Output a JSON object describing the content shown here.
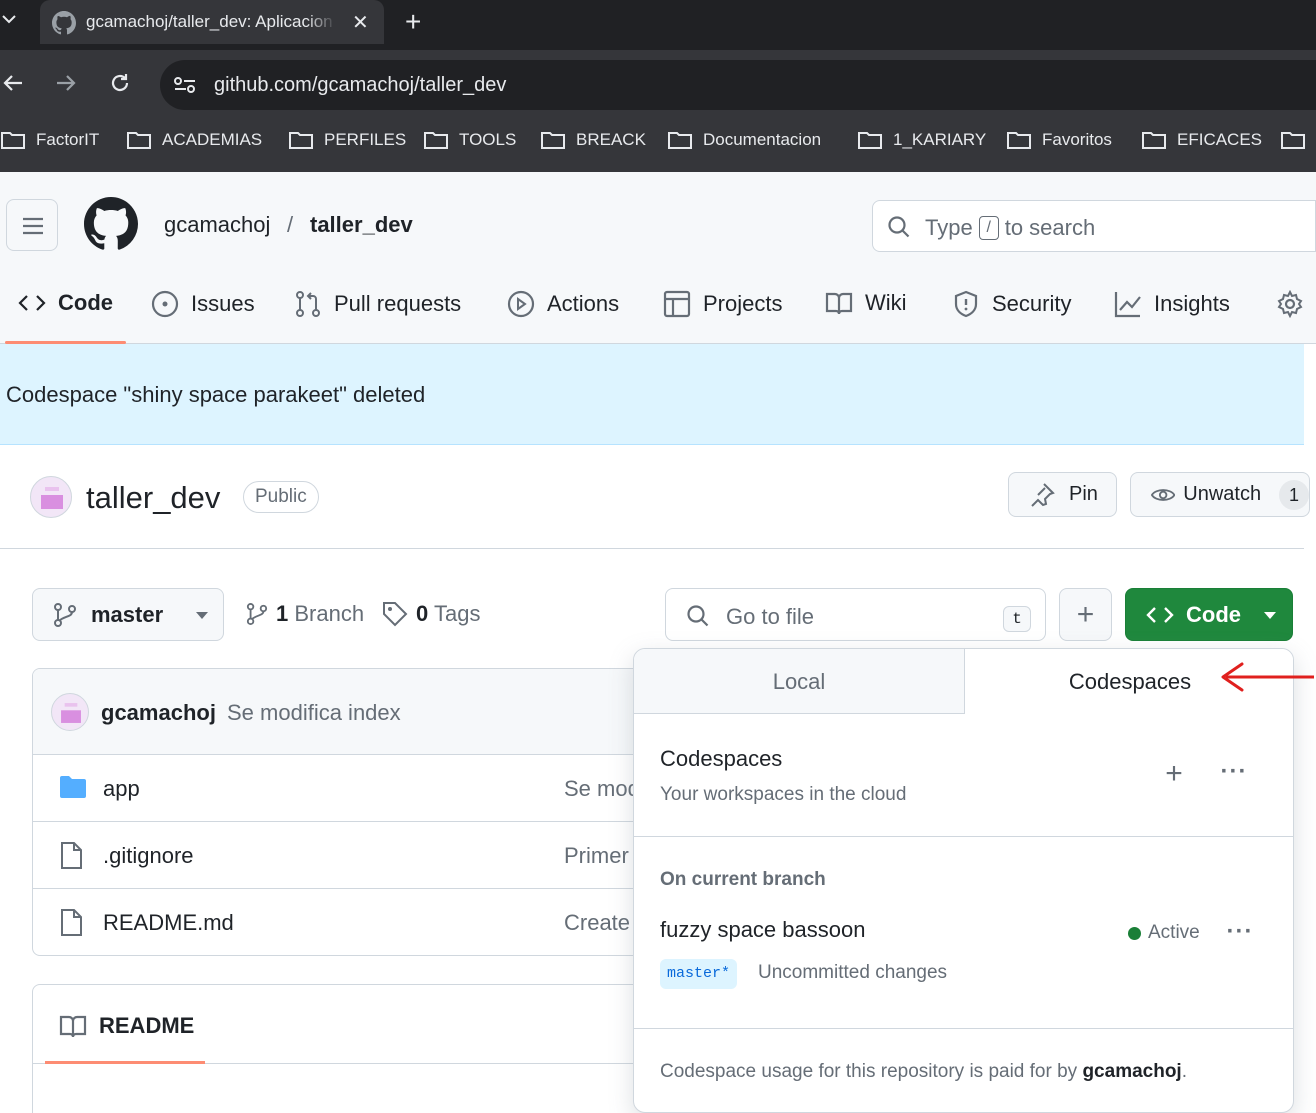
{
  "browser": {
    "tab_title": "gcamachoj/taller_dev: Aplicacion",
    "tab_close": "✕",
    "new_tab": "+",
    "url": "github.com/gcamachoj/taller_dev",
    "bookmarks": [
      "FactorIT",
      "ACADEMIAS",
      "PERFILES",
      "TOOLS",
      "BREACK",
      "Documentacion",
      "1_KARIARY",
      "Favoritos",
      "EFICACES"
    ]
  },
  "header": {
    "owner": "gcamachoj",
    "separator": "/",
    "repo": "taller_dev",
    "search_prefix": "Type",
    "search_key": "/",
    "search_suffix": "to search"
  },
  "repo_nav": {
    "tabs": [
      "Code",
      "Issues",
      "Pull requests",
      "Actions",
      "Projects",
      "Wiki",
      "Security",
      "Insights"
    ],
    "active": "Code"
  },
  "flash": {
    "message": "Codespace \"shiny space parakeet\" deleted"
  },
  "repo": {
    "name": "taller_dev",
    "visibility": "Public",
    "pin_label": "Pin",
    "watch_label": "Unwatch",
    "watch_count": "1"
  },
  "controls": {
    "branch": "master",
    "branches_count": "1",
    "branches_label": "Branch",
    "tags_count": "0",
    "tags_label": "Tags",
    "goto_placeholder": "Go to file",
    "goto_key": "t",
    "plus": "+",
    "code_label": "Code"
  },
  "files": {
    "commit_author": "gcamachoj",
    "commit_message": "Se modifica index",
    "rows": [
      {
        "name": "app",
        "type": "folder",
        "message": "Se modifica index"
      },
      {
        "name": ".gitignore",
        "type": "file",
        "message": "Primer commit"
      },
      {
        "name": "README.md",
        "type": "file",
        "message": "Create README.md"
      }
    ]
  },
  "readme": {
    "label": "README"
  },
  "code_dropdown": {
    "tabs": [
      "Local",
      "Codespaces"
    ],
    "active_tab": "Codespaces",
    "title": "Codespaces",
    "subtitle": "Your workspaces in the cloud",
    "add": "+",
    "more": "···",
    "section": "On current branch",
    "codespace": {
      "name": "fuzzy space bassoon",
      "status": "Active",
      "branch": "master*",
      "changes": "Uncommitted changes"
    },
    "footer_prefix": "Codespace usage for this repository is paid for by",
    "footer_owner": "gcamachoj",
    "footer_suffix": "."
  },
  "colors": {
    "primary_button": "#1f883d",
    "flash_bg": "#ddf4ff",
    "active_underline": "#fd8c73",
    "annotation_arrow": "#e0201e"
  }
}
